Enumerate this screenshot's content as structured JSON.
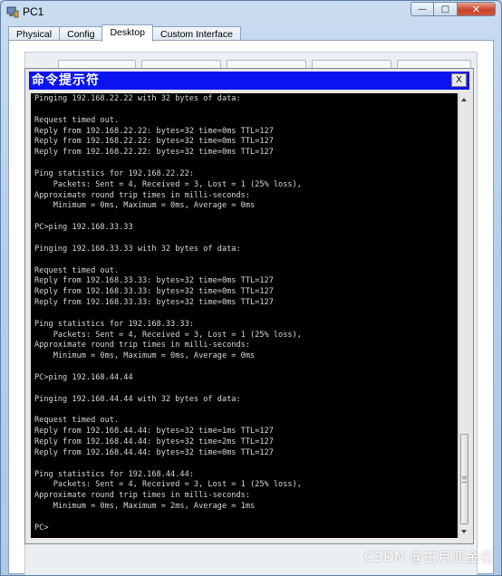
{
  "window": {
    "title": "PC1",
    "icon": "pc-icon",
    "controls": {
      "minimize": "—",
      "maximize": "□",
      "close": "✕"
    }
  },
  "tabs": [
    {
      "label": "Physical",
      "active": false
    },
    {
      "label": "Config",
      "active": false
    },
    {
      "label": "Desktop",
      "active": true
    },
    {
      "label": "Custom Interface",
      "active": false
    }
  ],
  "cmd": {
    "title": "命令提示符",
    "close_label": "X",
    "lines": [
      "Pinging 192.168.22.22 with 32 bytes of data:",
      "",
      "Request timed out.",
      "Reply from 192.168.22.22: bytes=32 time=0ms TTL=127",
      "Reply from 192.168.22.22: bytes=32 time=0ms TTL=127",
      "Reply from 192.168.22.22: bytes=32 time=0ms TTL=127",
      "",
      "Ping statistics for 192.168.22.22:",
      "    Packets: Sent = 4, Received = 3, Lost = 1 (25% loss),",
      "Approximate round trip times in milli-seconds:",
      "    Minimum = 0ms, Maximum = 0ms, Average = 0ms",
      "",
      "PC>ping 192.168.33.33",
      "",
      "Pinging 192.168.33.33 with 32 bytes of data:",
      "",
      "Request timed out.",
      "Reply from 192.168.33.33: bytes=32 time=0ms TTL=127",
      "Reply from 192.168.33.33: bytes=32 time=0ms TTL=127",
      "Reply from 192.168.33.33: bytes=32 time=0ms TTL=127",
      "",
      "Ping statistics for 192.168.33.33:",
      "    Packets: Sent = 4, Received = 3, Lost = 1 (25% loss),",
      "Approximate round trip times in milli-seconds:",
      "    Minimum = 0ms, Maximum = 0ms, Average = 0ms",
      "",
      "PC>ping 192.168.44.44",
      "",
      "Pinging 192.168.44.44 with 32 bytes of data:",
      "",
      "Request timed out.",
      "Reply from 192.168.44.44: bytes=32 time=1ms TTL=127",
      "Reply from 192.168.44.44: bytes=32 time=2ms TTL=127",
      "Reply from 192.168.44.44: bytes=32 time=0ms TTL=127",
      "",
      "Ping statistics for 192.168.44.44:",
      "    Packets: Sent = 4, Received = 3, Lost = 1 (25% loss),",
      "Approximate round trip times in milli-seconds:",
      "    Minimum = 0ms, Maximum = 2ms, Average = 1ms",
      "",
      "PC>"
    ]
  },
  "watermark": "CSDN @古月亚金名",
  "colors": {
    "cmd_title_bg": "#0a14f0",
    "console_bg": "#000000",
    "console_text": "#d8d8d8",
    "window_frame": "#b9d1ea",
    "close_button": "#c9452b"
  }
}
